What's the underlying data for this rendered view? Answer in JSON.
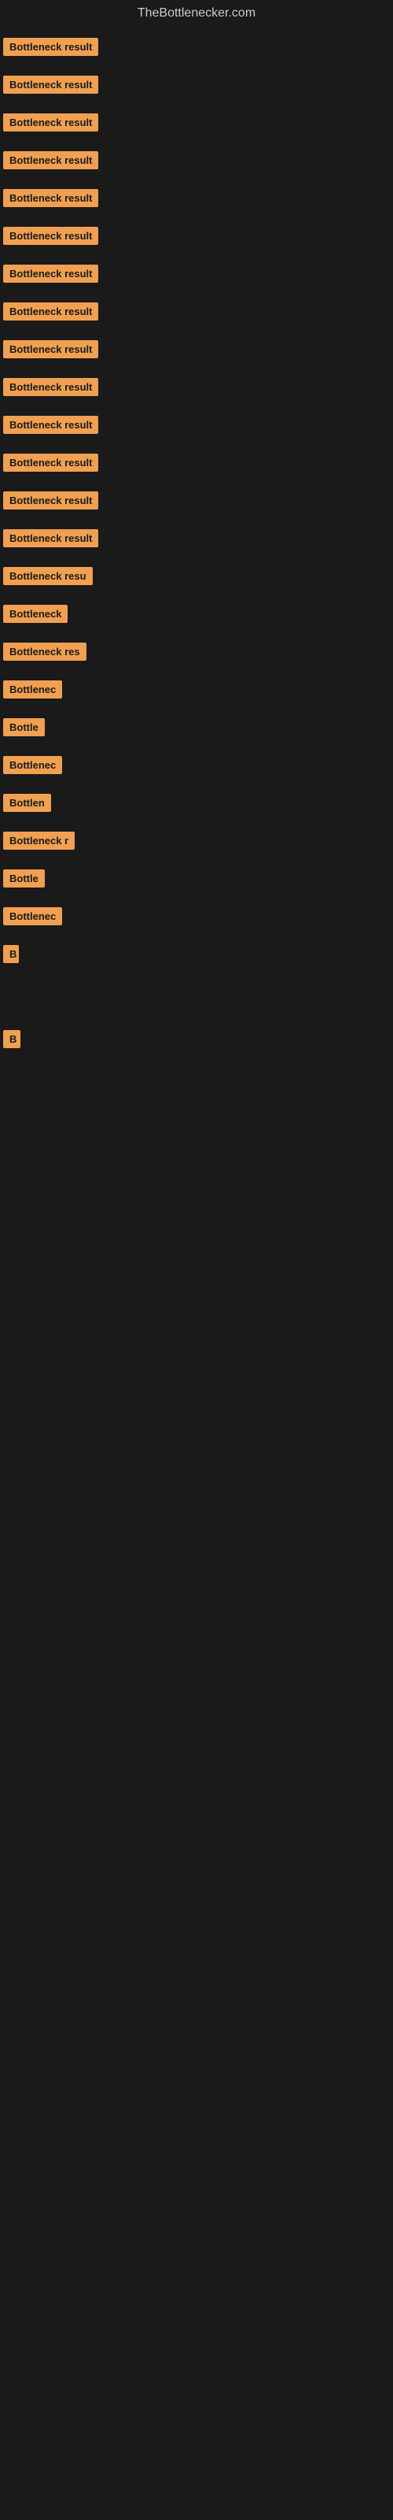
{
  "header": {
    "title": "TheBottlenecker.com"
  },
  "items": [
    {
      "id": 1,
      "label": "Bottleneck result",
      "width": 140
    },
    {
      "id": 2,
      "label": "Bottleneck result",
      "width": 140
    },
    {
      "id": 3,
      "label": "Bottleneck result",
      "width": 140
    },
    {
      "id": 4,
      "label": "Bottleneck result",
      "width": 140
    },
    {
      "id": 5,
      "label": "Bottleneck result",
      "width": 140
    },
    {
      "id": 6,
      "label": "Bottleneck result",
      "width": 140
    },
    {
      "id": 7,
      "label": "Bottleneck result",
      "width": 140
    },
    {
      "id": 8,
      "label": "Bottleneck result",
      "width": 140
    },
    {
      "id": 9,
      "label": "Bottleneck result",
      "width": 140
    },
    {
      "id": 10,
      "label": "Bottleneck result",
      "width": 140
    },
    {
      "id": 11,
      "label": "Bottleneck result",
      "width": 140
    },
    {
      "id": 12,
      "label": "Bottleneck result",
      "width": 140
    },
    {
      "id": 13,
      "label": "Bottleneck result",
      "width": 140
    },
    {
      "id": 14,
      "label": "Bottleneck result",
      "width": 135
    },
    {
      "id": 15,
      "label": "Bottleneck resu",
      "width": 118
    },
    {
      "id": 16,
      "label": "Bottleneck",
      "width": 85
    },
    {
      "id": 17,
      "label": "Bottleneck res",
      "width": 108
    },
    {
      "id": 18,
      "label": "Bottlenec",
      "width": 76
    },
    {
      "id": 19,
      "label": "Bottle",
      "width": 58
    },
    {
      "id": 20,
      "label": "Bottlenec",
      "width": 76
    },
    {
      "id": 21,
      "label": "Bottlen",
      "width": 64
    },
    {
      "id": 22,
      "label": "Bottleneck r",
      "width": 92
    },
    {
      "id": 23,
      "label": "Bottle",
      "width": 55
    },
    {
      "id": 24,
      "label": "Bottlenec",
      "width": 76
    },
    {
      "id": 25,
      "label": "B",
      "width": 20
    },
    {
      "id": 26,
      "label": "",
      "width": 0
    },
    {
      "id": 27,
      "label": "",
      "width": 0
    },
    {
      "id": 28,
      "label": "",
      "width": 0
    },
    {
      "id": 29,
      "label": "B",
      "width": 22
    },
    {
      "id": 30,
      "label": "",
      "width": 0
    },
    {
      "id": 31,
      "label": "",
      "width": 0
    },
    {
      "id": 32,
      "label": "",
      "width": 0
    },
    {
      "id": 33,
      "label": "",
      "width": 0
    },
    {
      "id": 34,
      "label": "",
      "width": 0
    },
    {
      "id": 35,
      "label": "",
      "width": 0
    }
  ]
}
